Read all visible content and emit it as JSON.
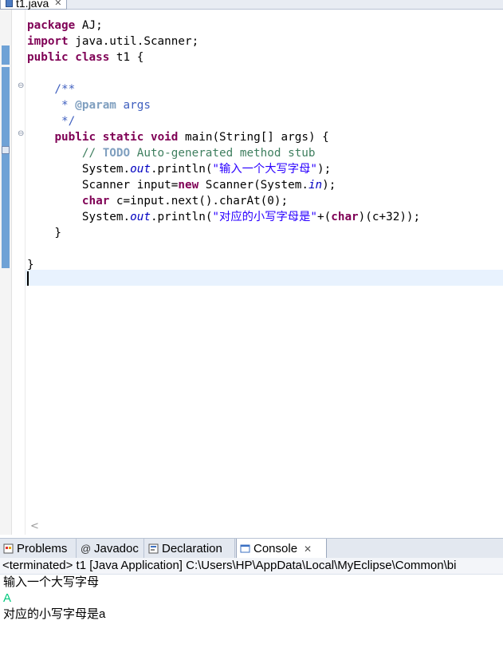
{
  "editor_tab": {
    "label": "t1.java"
  },
  "code_lines": [
    [
      {
        "t": "package",
        "c": "kw"
      },
      {
        "t": " AJ;",
        "c": ""
      }
    ],
    [
      {
        "t": "import",
        "c": "kw"
      },
      {
        "t": " java.util.Scanner;",
        "c": ""
      }
    ],
    [
      {
        "t": "public",
        "c": "kw"
      },
      {
        "t": " ",
        "c": ""
      },
      {
        "t": "class",
        "c": "kw"
      },
      {
        "t": " t1 {",
        "c": ""
      }
    ],
    [],
    [
      {
        "t": "    /**",
        "c": "jd"
      }
    ],
    [
      {
        "t": "     * ",
        "c": "jd"
      },
      {
        "t": "@param",
        "c": "jdtag"
      },
      {
        "t": " args",
        "c": "jd"
      }
    ],
    [
      {
        "t": "     */",
        "c": "jd"
      }
    ],
    [
      {
        "t": "    ",
        "c": ""
      },
      {
        "t": "public",
        "c": "kw"
      },
      {
        "t": " ",
        "c": ""
      },
      {
        "t": "static",
        "c": "kw"
      },
      {
        "t": " ",
        "c": ""
      },
      {
        "t": "void",
        "c": "kw"
      },
      {
        "t": " main(String[] args) {",
        "c": ""
      }
    ],
    [
      {
        "t": "        // ",
        "c": "cm"
      },
      {
        "t": "TODO",
        "c": "todo"
      },
      {
        "t": " Auto-generated method stub",
        "c": "cm"
      }
    ],
    [
      {
        "t": "        System.",
        "c": ""
      },
      {
        "t": "out",
        "c": "fld"
      },
      {
        "t": ".println(",
        "c": ""
      },
      {
        "t": "\"输入一个大写字母\"",
        "c": "str"
      },
      {
        "t": ");",
        "c": ""
      }
    ],
    [
      {
        "t": "        Scanner input=",
        "c": ""
      },
      {
        "t": "new",
        "c": "kw"
      },
      {
        "t": " Scanner(System.",
        "c": ""
      },
      {
        "t": "in",
        "c": "fld"
      },
      {
        "t": ");",
        "c": ""
      }
    ],
    [
      {
        "t": "        ",
        "c": ""
      },
      {
        "t": "char",
        "c": "kw"
      },
      {
        "t": " c=input.next().charAt(0);",
        "c": ""
      }
    ],
    [
      {
        "t": "        System.",
        "c": ""
      },
      {
        "t": "out",
        "c": "fld"
      },
      {
        "t": ".println(",
        "c": ""
      },
      {
        "t": "\"对应的小写字母是\"",
        "c": "str"
      },
      {
        "t": "+(",
        "c": ""
      },
      {
        "t": "char",
        "c": "kw"
      },
      {
        "t": ")(c+32));",
        "c": ""
      }
    ],
    [
      {
        "t": "    }",
        "c": ""
      }
    ],
    [],
    [
      {
        "t": "}",
        "c": ""
      }
    ],
    []
  ],
  "panel_tabs": [
    {
      "label": "Problems",
      "icon": "problems-icon"
    },
    {
      "label": "Javadoc",
      "icon": "javadoc-icon"
    },
    {
      "label": "Declaration",
      "icon": "declaration-icon"
    },
    {
      "label": "Console",
      "icon": "console-icon",
      "active": true
    }
  ],
  "console": {
    "header": "<terminated> t1 [Java Application] C:\\Users\\HP\\AppData\\Local\\MyEclipse\\Common\\bi",
    "lines": [
      {
        "text": "输入一个大写字母",
        "kind": "out"
      },
      {
        "text": "A",
        "kind": "in"
      },
      {
        "text": "对应的小写字母是a",
        "kind": "out"
      }
    ]
  },
  "colors": {
    "keyword": "#7f0055",
    "comment": "#3f7f5f",
    "javadoc": "#3f5fbf",
    "string": "#2a00ff",
    "field": "#0000c0",
    "console_input": "#00c87d",
    "current_line": "#e8f2fe"
  }
}
